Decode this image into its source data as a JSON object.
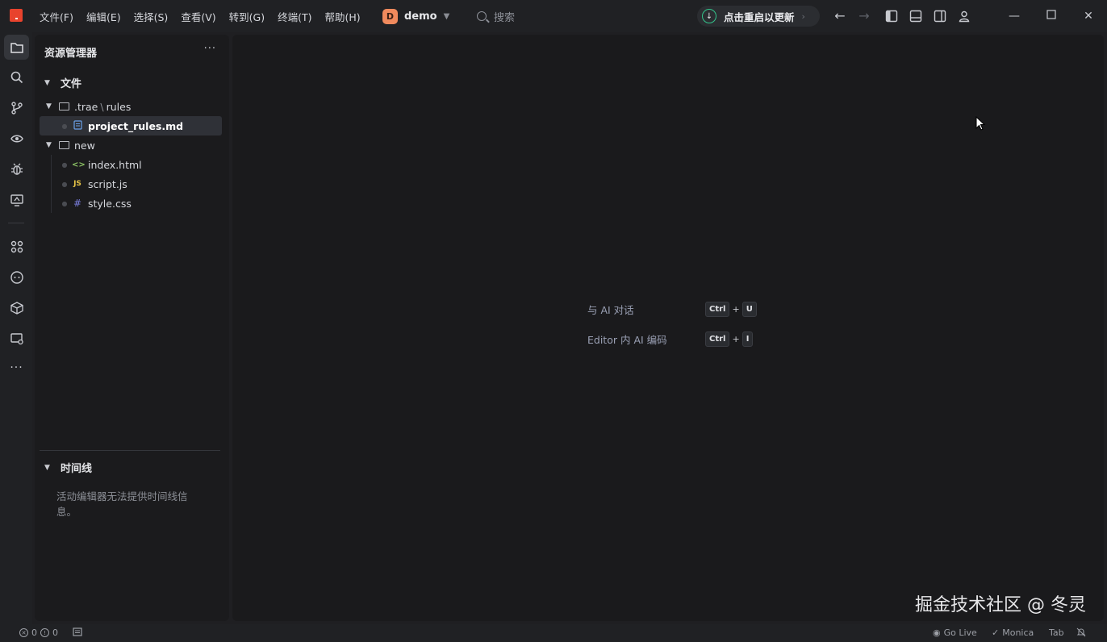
{
  "menu": [
    "文件(F)",
    "编辑(E)",
    "选择(S)",
    "查看(V)",
    "转到(G)",
    "终端(T)",
    "帮助(H)"
  ],
  "project": {
    "badge": "D",
    "name": "demo"
  },
  "search": {
    "label": "搜索"
  },
  "update": {
    "label": "点击重启以更新"
  },
  "colors": {
    "accent": "#33c48b",
    "logo": "#e8432d",
    "project_badge": "#f08a5d"
  },
  "sidebar": {
    "title": "资源管理器",
    "more": "···",
    "files_section": "文件",
    "tree": [
      {
        "label": ".trae",
        "sep": "\\",
        "label2": "rules",
        "type": "folder"
      },
      {
        "label": "project_rules.md",
        "type": "md",
        "selected": true
      },
      {
        "label": "new",
        "type": "folder"
      },
      {
        "label": "index.html",
        "type": "html",
        "icon": "<>"
      },
      {
        "label": "script.js",
        "type": "js",
        "icon": "JS"
      },
      {
        "label": "style.css",
        "type": "css",
        "icon": "#"
      }
    ],
    "timeline_section": "时间线",
    "timeline_message": "活动编辑器无法提供时间线信息。"
  },
  "editor": {
    "hints": [
      {
        "label": "与 AI 对话",
        "key1": "Ctrl",
        "plus": "+",
        "key2": "U"
      },
      {
        "label": "Editor 内 AI 编码",
        "key1": "Ctrl",
        "plus": "+",
        "key2": "I"
      }
    ],
    "watermark": "掘金技术社区 @ 冬灵"
  },
  "status": {
    "errors": "0",
    "warnings": "0",
    "go_live": "Go Live",
    "monica": "Monica",
    "tab": "Tab"
  }
}
